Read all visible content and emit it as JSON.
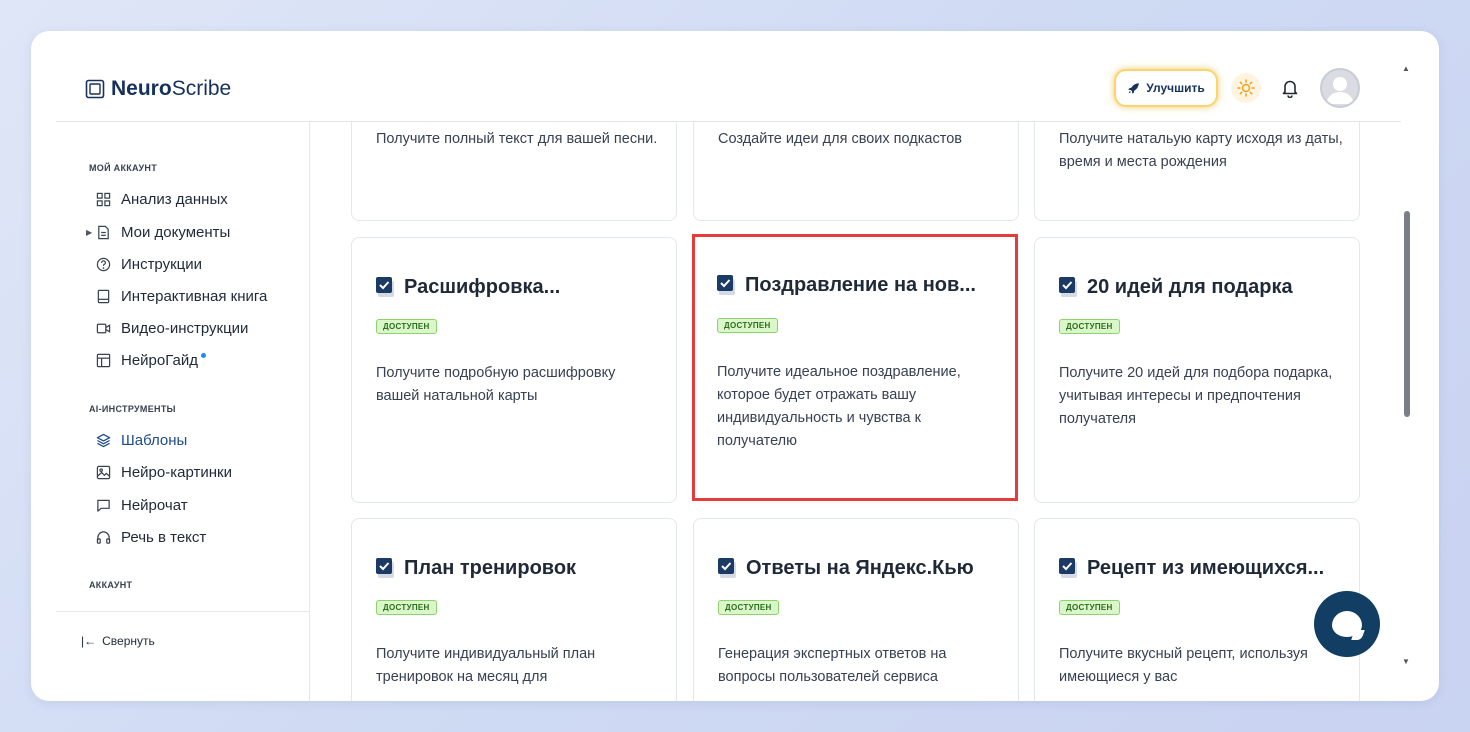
{
  "app": {
    "logo_bold": "Neuro",
    "logo_light": "Scribe"
  },
  "header": {
    "upgrade_label": "Улучшить"
  },
  "sidebar": {
    "section_account": "МОЙ АККАУНТ",
    "items_account": [
      {
        "label": "Анализ данных",
        "icon": "grid-icon"
      },
      {
        "label": "Мои документы",
        "icon": "document-icon"
      },
      {
        "label": "Инструкции",
        "icon": "help-circle-icon"
      },
      {
        "label": "Интерактивная книга",
        "icon": "book-icon"
      },
      {
        "label": "Видео-инструкции",
        "icon": "video-icon"
      },
      {
        "label": "НейроГайд",
        "icon": "layout-icon"
      }
    ],
    "section_ai": "AI-ИНСТРУМЕНТЫ",
    "items_ai": [
      {
        "label": "Шаблоны",
        "icon": "layers-icon",
        "active": true
      },
      {
        "label": "Нейро-картинки",
        "icon": "image-icon"
      },
      {
        "label": "Нейрочат",
        "icon": "message-icon"
      },
      {
        "label": "Речь в текст",
        "icon": "headphones-icon"
      }
    ],
    "section_profile": "АККАУНТ",
    "collapse_label": "Свернуть"
  },
  "cards_top": [
    {
      "desc": "Получите полный текст для вашей песни."
    },
    {
      "desc": "Создайте идеи для своих подкастов"
    },
    {
      "desc": "Получите натальую карту исходя из даты, время и места рождения"
    }
  ],
  "cards": [
    {
      "title": "Расшифровка...",
      "badge": "ДОСТУПЕН",
      "desc": "Получите подробную расшифровку вашей натальной карты"
    },
    {
      "title": "Поздравление на нов...",
      "badge": "ДОСТУПЕН",
      "desc": "Получите идеальное поздравление, которое будет отражать вашу индивидуальность и чувства к получателю"
    },
    {
      "title": "20 идей для подарка",
      "badge": "ДОСТУПЕН",
      "desc": "Получите 20 идей для подбора подарка, учитывая интересы и предпочтения получателя"
    },
    {
      "title": "План тренировок",
      "badge": "ДОСТУПЕН",
      "desc": "Получите индивидуальный план тренировок на месяц для"
    },
    {
      "title": "Ответы на Яндекс.Кью",
      "badge": "ДОСТУПЕН",
      "desc": "Генерация экспертных ответов на вопросы пользователей сервиса"
    },
    {
      "title": "Рецепт из имеющихся...",
      "badge": "ДОСТУПЕН",
      "desc": "Получите вкусный рецепт, используя имеющиеся у вас"
    }
  ],
  "colors": {
    "brand": "#16325c",
    "highlight": "#e43b3b",
    "badge_bg": "#d9f7c8",
    "chat": "#123e63"
  }
}
